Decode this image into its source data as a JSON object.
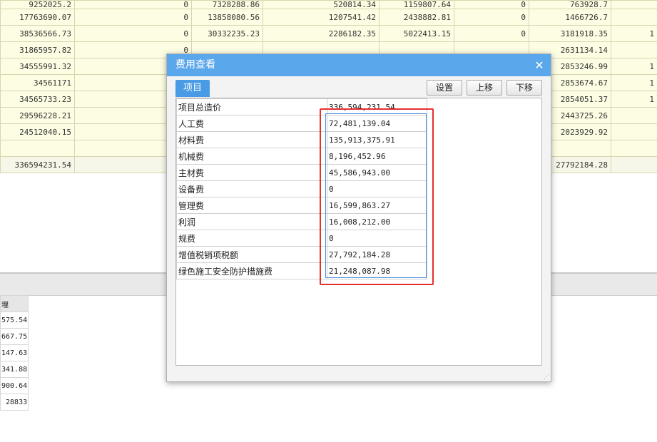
{
  "background_table": {
    "rows": [
      [
        "9252025.2",
        "0",
        "7328288.86",
        "520814.34",
        "1159807.64",
        "0",
        "763928.7",
        ""
      ],
      [
        "17763690.07",
        "0",
        "13858080.56",
        "1207541.42",
        "2438882.81",
        "0",
        "1466726.7",
        ""
      ],
      [
        "38536566.73",
        "0",
        "30332235.23",
        "2286182.35",
        "5022413.15",
        "0",
        "3181918.35",
        "1"
      ],
      [
        "31865957.82",
        "0",
        "",
        "",
        "",
        "",
        "2631134.14",
        ""
      ],
      [
        "34555991.32",
        "",
        "",
        "",
        "",
        "",
        "2853246.99",
        "1"
      ],
      [
        "34561171",
        "",
        "",
        "",
        "",
        "",
        "2853674.67",
        "1"
      ],
      [
        "34565733.23",
        "",
        "",
        "",
        "",
        "",
        "2854051.37",
        "1"
      ],
      [
        "29596228.21",
        "",
        "",
        "",
        "",
        "",
        "2443725.26",
        ""
      ],
      [
        "24512040.15",
        "",
        "",
        "",
        "",
        "",
        "2023929.92",
        ""
      ],
      [
        "",
        "",
        "",
        "",
        "",
        "",
        "",
        ""
      ],
      [
        "336594231.54",
        "",
        "",
        "",
        "",
        "",
        "27792184.28",
        ""
      ]
    ]
  },
  "left_table": {
    "header": "埋",
    "rows": [
      "575.54",
      "667.75",
      "147.63",
      "341.88",
      "900.64",
      "28833"
    ]
  },
  "dialog": {
    "title": "费用查看",
    "close_icon": "✕",
    "tab_label": "项目",
    "buttons": {
      "setup": "设置",
      "move_up": "上移",
      "move_down": "下移"
    },
    "rows": [
      {
        "name": "项目总造价",
        "value": "336,594,231.54"
      },
      {
        "name": "人工费",
        "value": "72,481,139.04"
      },
      {
        "name": "材料费",
        "value": "135,913,375.91"
      },
      {
        "name": "机械费",
        "value": "8,196,452.96"
      },
      {
        "name": "主材费",
        "value": "45,586,943.00"
      },
      {
        "name": "设备费",
        "value": "0"
      },
      {
        "name": "管理费",
        "value": "16,599,863.27"
      },
      {
        "name": "利润",
        "value": "16,008,212.00"
      },
      {
        "name": "规费",
        "value": "0"
      },
      {
        "name": "增值税销项税额",
        "value": "27,792,184.28"
      },
      {
        "name": "绿色施工安全防护措施费",
        "value": "21,248,087.98"
      }
    ]
  },
  "colors": {
    "title_bar": "#5aa7ec",
    "tab": "#4a9be6",
    "highlight_box": "#e53030",
    "selection": "#4a8fe0",
    "sheet_bg": "#fdfde3"
  }
}
